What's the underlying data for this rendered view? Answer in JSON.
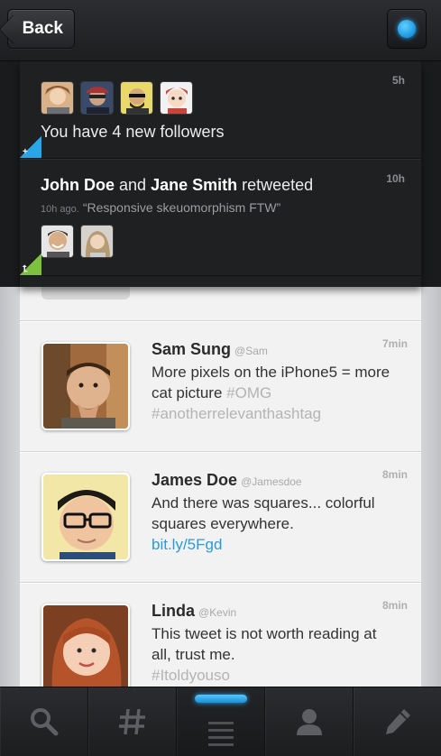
{
  "header": {
    "back_label": "Back",
    "accent": "#26a8f5"
  },
  "notifications": [
    {
      "time": "5h",
      "text": "You have 4 new followers",
      "avatar_count": 4,
      "tag_color": "#2aa6e8",
      "tag_icon": "plus-icon"
    },
    {
      "time": "10h",
      "user_a": "John Doe",
      "joiner": "and",
      "user_b": "Jane Smith",
      "action": "retweeted",
      "sub_ago": "10h ago.",
      "sub_quote": "“Responsive skeuomorphism FTW”",
      "avatar_count": 2,
      "tag_color": "#7dc13e",
      "tag_icon": "retweet-icon"
    }
  ],
  "tweets": [
    {
      "name": "Sam Sung",
      "handle": "@Sam",
      "time": "7min",
      "text": "More pixels on the iPhone5 = more cat picture",
      "hashtags": "#OMG #anotherrelevanthashtag"
    },
    {
      "name": "James Doe",
      "handle": "@Jamesdoe",
      "time": "8min",
      "text": "And there was squares... colorful squares everywhere.",
      "link": "bit.ly/5Fgd"
    },
    {
      "name": "Linda",
      "handle": "@Kevin",
      "time": "8min",
      "text": "This tweet is not worth reading at all, trust me.",
      "hashtags": "#Itoldyouso"
    }
  ],
  "tabbar": {
    "tabs": [
      "search-icon",
      "hashtag-icon",
      "list-icon",
      "profile-icon",
      "compose-icon"
    ],
    "active_index": 2,
    "accent": "#2ba6ef"
  }
}
